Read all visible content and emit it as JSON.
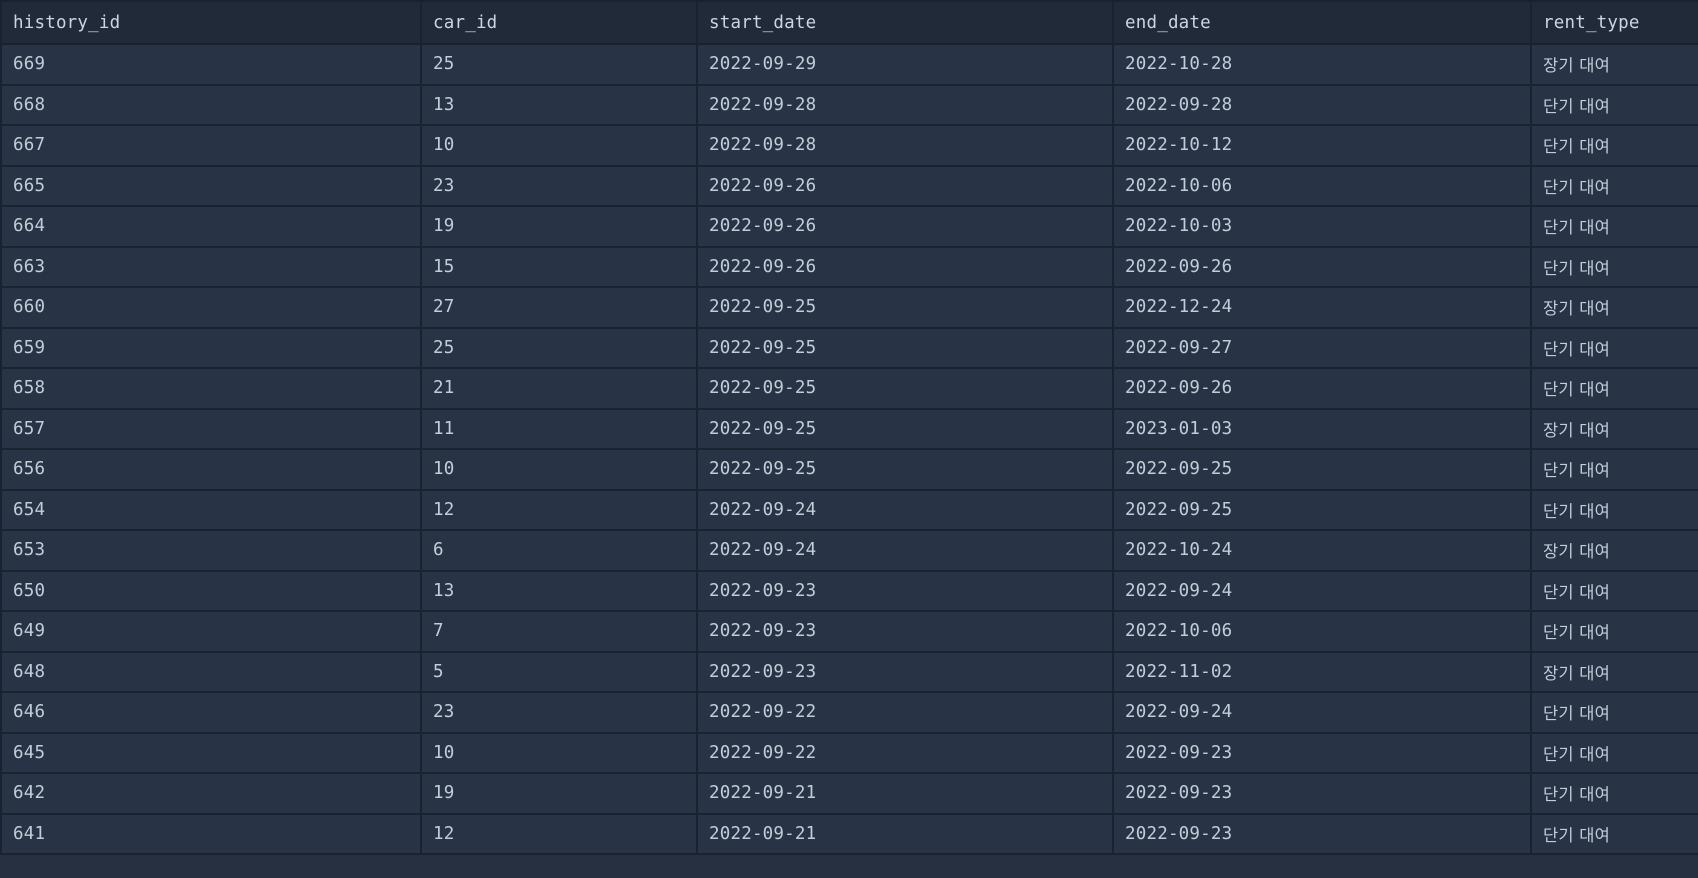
{
  "table": {
    "columns": [
      "history_id",
      "car_id",
      "start_date",
      "end_date",
      "rent_type"
    ],
    "rows": [
      [
        "669",
        "25",
        "2022-09-29",
        "2022-10-28",
        "장기 대여"
      ],
      [
        "668",
        "13",
        "2022-09-28",
        "2022-09-28",
        "단기 대여"
      ],
      [
        "667",
        "10",
        "2022-09-28",
        "2022-10-12",
        "단기 대여"
      ],
      [
        "665",
        "23",
        "2022-09-26",
        "2022-10-06",
        "단기 대여"
      ],
      [
        "664",
        "19",
        "2022-09-26",
        "2022-10-03",
        "단기 대여"
      ],
      [
        "663",
        "15",
        "2022-09-26",
        "2022-09-26",
        "단기 대여"
      ],
      [
        "660",
        "27",
        "2022-09-25",
        "2022-12-24",
        "장기 대여"
      ],
      [
        "659",
        "25",
        "2022-09-25",
        "2022-09-27",
        "단기 대여"
      ],
      [
        "658",
        "21",
        "2022-09-25",
        "2022-09-26",
        "단기 대여"
      ],
      [
        "657",
        "11",
        "2022-09-25",
        "2023-01-03",
        "장기 대여"
      ],
      [
        "656",
        "10",
        "2022-09-25",
        "2022-09-25",
        "단기 대여"
      ],
      [
        "654",
        "12",
        "2022-09-24",
        "2022-09-25",
        "단기 대여"
      ],
      [
        "653",
        "6",
        "2022-09-24",
        "2022-10-24",
        "장기 대여"
      ],
      [
        "650",
        "13",
        "2022-09-23",
        "2022-09-24",
        "단기 대여"
      ],
      [
        "649",
        "7",
        "2022-09-23",
        "2022-10-06",
        "단기 대여"
      ],
      [
        "648",
        "5",
        "2022-09-23",
        "2022-11-02",
        "장기 대여"
      ],
      [
        "646",
        "23",
        "2022-09-22",
        "2022-09-24",
        "단기 대여"
      ],
      [
        "645",
        "10",
        "2022-09-22",
        "2022-09-23",
        "단기 대여"
      ],
      [
        "642",
        "19",
        "2022-09-21",
        "2022-09-23",
        "단기 대여"
      ],
      [
        "641",
        "12",
        "2022-09-21",
        "2022-09-23",
        "단기 대여"
      ]
    ]
  },
  "colors": {
    "background": "#283445",
    "header_background": "#202a39",
    "grid_line": "#1a2230",
    "text": "#c3ccd8"
  }
}
